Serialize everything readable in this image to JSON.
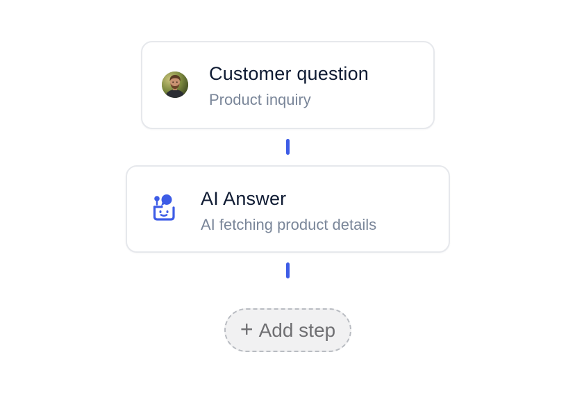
{
  "flow": {
    "steps": [
      {
        "title": "Customer question",
        "subtitle": "Product inquiry",
        "icon": "user-avatar"
      },
      {
        "title": "AI Answer",
        "subtitle": "AI fetching product details",
        "icon": "bot-icon"
      }
    ],
    "add_step": {
      "icon": "plus-icon",
      "label": "Add step"
    }
  },
  "colors": {
    "accent": "#3d5ce6",
    "title_text": "#0f1b33",
    "subtitle_text": "#7a8699",
    "card_border": "#e6e8ec",
    "add_step_bg": "#f1f1f2",
    "add_step_text": "#6f6f72"
  }
}
